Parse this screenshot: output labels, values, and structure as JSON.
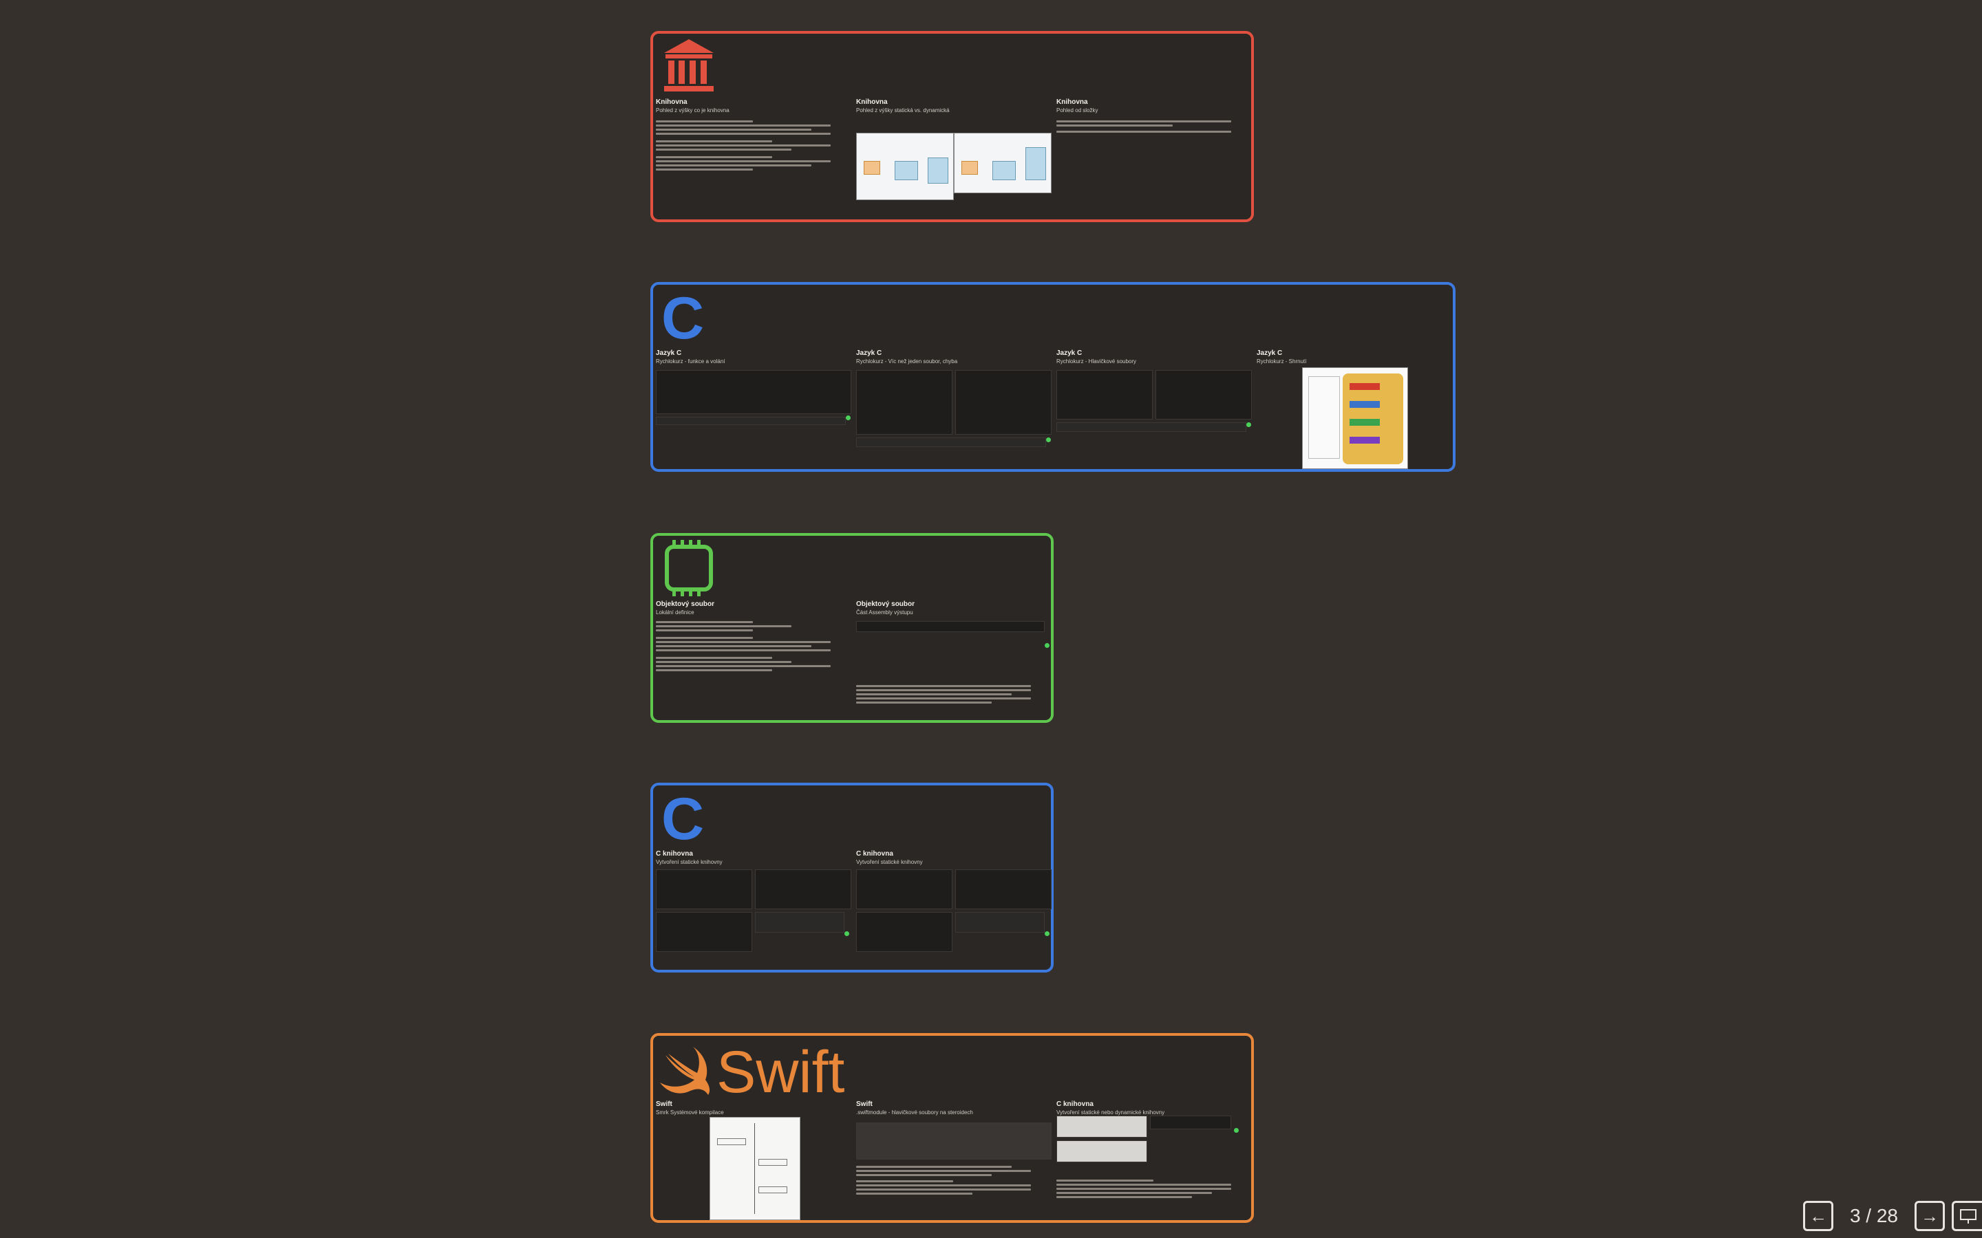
{
  "groups": {
    "library": {
      "color": "#e2503f",
      "icon": "bank-icon",
      "slides": [
        {
          "title": "Knihovna",
          "subtitle": "Pohled z výšky co je knihovna"
        },
        {
          "title": "Knihovna",
          "subtitle": "Pohled z výšky statická vs. dynamická"
        },
        {
          "title": "Knihovna",
          "subtitle": "Pohled od složky"
        }
      ]
    },
    "clang": {
      "color": "#3c7ae0",
      "icon": "c-letter-icon",
      "icon_text": "C",
      "slides": [
        {
          "title": "Jazyk C",
          "subtitle": "Rychlokurz - funkce a volání"
        },
        {
          "title": "Jazyk C",
          "subtitle": "Rychlokurz - Víc než jeden soubor, chyba"
        },
        {
          "title": "Jazyk C",
          "subtitle": "Rychlokurz - Hlavičkové soubory"
        },
        {
          "title": "Jazyk C",
          "subtitle": "Rychlokurz - Shrnutí"
        }
      ]
    },
    "object_file": {
      "color": "#5fc74e",
      "icon": "chip-icon",
      "slides": [
        {
          "title": "Objektový soubor",
          "subtitle": "Lokální definice"
        },
        {
          "title": "Objektový soubor",
          "subtitle": "Část Assembly výstupu"
        }
      ]
    },
    "c_library": {
      "color": "#3c7ae0",
      "icon": "c-letter-icon",
      "icon_text": "C",
      "slides": [
        {
          "title": "C knihovna",
          "subtitle": "Vytvoření statické knihovny"
        },
        {
          "title": "C knihovna",
          "subtitle": "Vytvoření statické knihovny"
        }
      ]
    },
    "swift": {
      "color": "#e8873a",
      "icon": "swift-logo-icon",
      "wordmark": "Swift",
      "slides": [
        {
          "title": "Swift",
          "subtitle": "Smrk Systémové kompilace"
        },
        {
          "title": "Swift",
          "subtitle": ".swiftmodule - hlavičkové soubory na steroidech"
        },
        {
          "title": "C knihovna",
          "subtitle": "Vytvoření statické nebo dynamické knihovny"
        }
      ]
    }
  },
  "nav": {
    "prev_icon": "arrow-left-icon",
    "next_icon": "arrow-right-icon",
    "counter": "3 / 28",
    "present_icon": "presenter-lock-icon"
  }
}
